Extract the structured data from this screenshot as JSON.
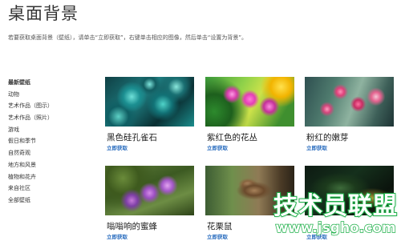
{
  "page": {
    "title": "桌面背景",
    "intro": "若要获取桌面背景（壁纸），请单击“立即获取”，右键单击相应的图像，然后单击“设置为背景”。"
  },
  "sidebar": {
    "items": [
      {
        "label": "最新壁纸",
        "active": true
      },
      {
        "label": "动物"
      },
      {
        "label": "艺术作品（图示）"
      },
      {
        "label": "艺术作品（照片）"
      },
      {
        "label": "游戏"
      },
      {
        "label": "假日和季节"
      },
      {
        "label": "自然奇观"
      },
      {
        "label": "地方和风景"
      },
      {
        "label": "植物和花卉"
      },
      {
        "label": "来自社区"
      },
      {
        "label": "全部壁纸"
      }
    ]
  },
  "wallpapers": [
    {
      "title": "黑色硅孔雀石",
      "action": "立即获取",
      "image": "peacock-ore"
    },
    {
      "title": "紫红色的花丛",
      "action": "立即获取",
      "image": "magenta-flowers"
    },
    {
      "title": "粉红的嫩芽",
      "action": "立即获取",
      "image": "pink-buds"
    },
    {
      "title": "嗡嗡响的蜜蜂",
      "action": "立即获取",
      "image": "bees-on-flowers"
    },
    {
      "title": "花栗鼠",
      "action": "立即获取",
      "image": "chipmunk"
    },
    {
      "title": "",
      "action": "立即获取",
      "image": "dark-forest"
    }
  ],
  "watermark": {
    "text": "技术员联盟",
    "url": "www.jsgho.com",
    "color": "#22b14c"
  },
  "colors": {
    "link": "#2a6dbf",
    "text": "#333333"
  }
}
